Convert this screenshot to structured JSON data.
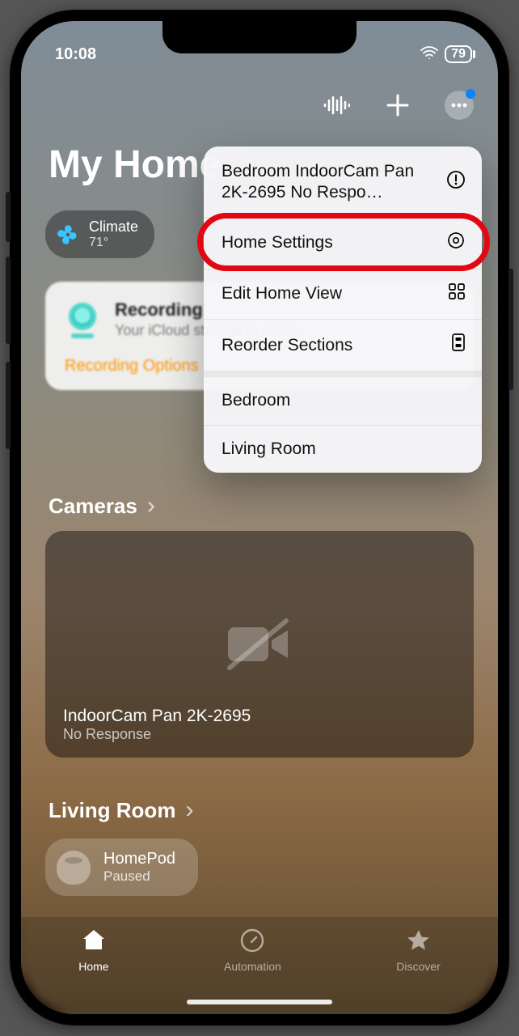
{
  "status": {
    "time": "10:08",
    "battery": "79"
  },
  "title": "My Home",
  "chip": {
    "label": "Climate",
    "value": "71°"
  },
  "notice": {
    "title": "Recording",
    "body_visible": "Your iCloud storage to allow…",
    "link_visible": "Recording Options"
  },
  "menu": {
    "items": [
      {
        "label": "Bedroom IndoorCam Pan 2K-2695 No Respo…",
        "icon": "alert-icon"
      },
      {
        "label": "Home Settings",
        "icon": "gear-icon",
        "highlighted": true
      },
      {
        "label": "Edit Home View",
        "icon": "grid-icon"
      },
      {
        "label": "Reorder Sections",
        "icon": "reorder-icon"
      },
      {
        "label": "Bedroom"
      },
      {
        "label": "Living Room"
      }
    ]
  },
  "cameras": {
    "header": "Cameras",
    "card": {
      "name": "IndoorCam Pan 2K-2695",
      "status": "No Response"
    }
  },
  "living_room": {
    "header": "Living Room",
    "device": {
      "name": "HomePod",
      "status": "Paused"
    }
  },
  "tabs": [
    {
      "label": "Home",
      "icon": "home-icon",
      "active": true
    },
    {
      "label": "Automation",
      "icon": "clock-icon"
    },
    {
      "label": "Discover",
      "icon": "star-icon"
    }
  ]
}
